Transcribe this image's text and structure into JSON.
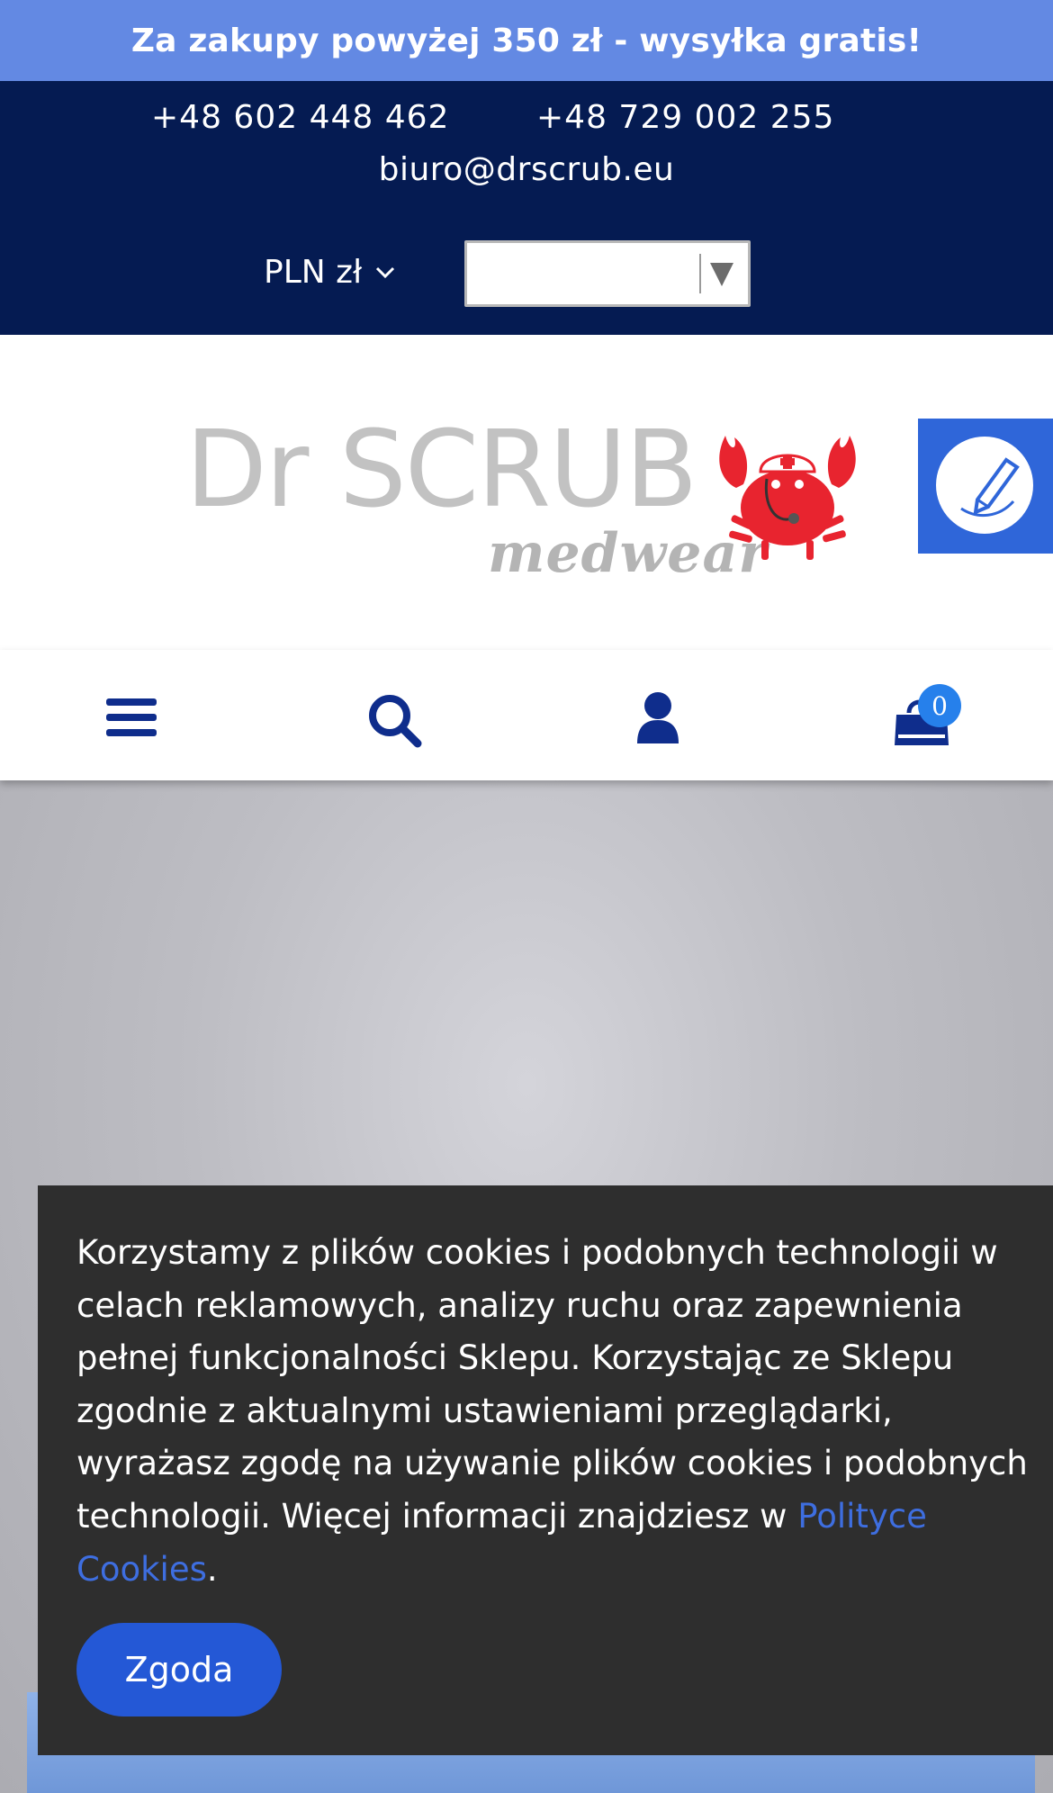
{
  "promo": {
    "text": "Za zakupy powyżej 350 zł - wysyłka gratis!"
  },
  "contact": {
    "phone_1": "+48 602 448 462",
    "phone_2": "+48 729 002 255",
    "email": "biuro@drscrub.eu"
  },
  "currency": {
    "selected": "PLN zł"
  },
  "language": {
    "selected": ""
  },
  "logo": {
    "brand": "Dr SCRUB",
    "subtitle": "medwear"
  },
  "nav": {
    "icons": [
      "menu-icon",
      "search-icon",
      "user-icon",
      "cart-icon"
    ],
    "cart_count": "0"
  },
  "cookie": {
    "text": "Korzystamy z plików cookies i podobnych technologii w celach reklamowych, analizy ruchu oraz zapewnienia pełnej funkcjonalności Sklepu. Korzystając ze Sklepu zgodnie z aktualnymi ustawieniami przeglądarki, wyrażasz zgodę na używanie plików cookies i podobnych technologii. Więcej informacji znajdziesz w ",
    "link_text": "Polityce Cookies",
    "after_link": ".",
    "button_label": "Zgoda"
  },
  "colors": {
    "promo_bg": "#6389e3",
    "header_bg": "#051b52",
    "nav_icon": "#0f2d8c",
    "accent": "#2458d6",
    "cookie_bg": "#2e2e2e",
    "crab_red": "#e8242f"
  }
}
